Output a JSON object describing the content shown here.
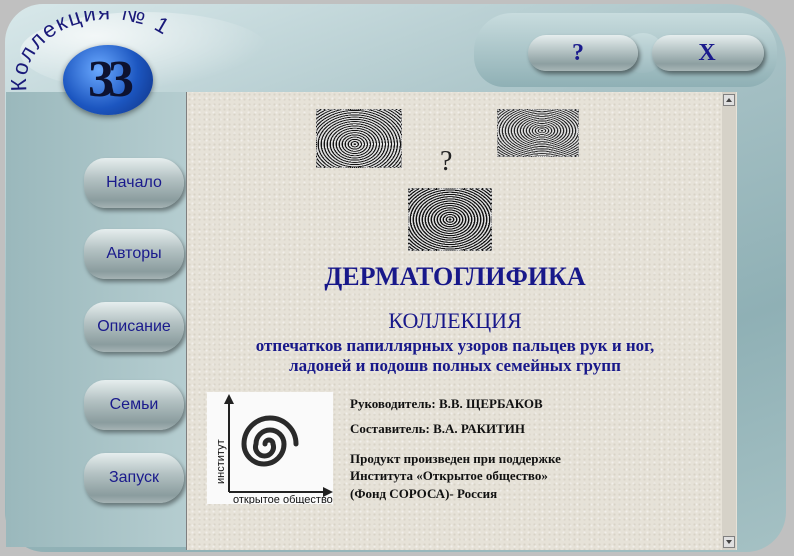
{
  "app": {
    "logo_ring_text": "Коллекция № 1",
    "logo_number": "33"
  },
  "window_controls": {
    "help_label": "?",
    "close_label": "X"
  },
  "nav": {
    "items": [
      {
        "label": "Начало"
      },
      {
        "label": "Авторы"
      },
      {
        "label": "Описание"
      },
      {
        "label": "Семьи"
      },
      {
        "label": "Запуск"
      }
    ]
  },
  "main": {
    "question_mark": "?",
    "title": "ДЕРМАТОГЛИФИКА",
    "subtitle": "КОЛЛЕКЦИЯ",
    "description_line1": "отпечатков папиллярных узоров пальцев рук и ног,",
    "description_line2": "ладоней и подошв полных семейных групп",
    "institute_logo": {
      "vertical_text": "институт",
      "bottom_text": "открытое общество"
    },
    "credits": {
      "leader": "Руководитель:  В.В. ЩЕРБАКОВ",
      "compiler": "Составитель: В.А. РАКИТИН",
      "support_line1": "Продукт произведен при поддержке",
      "support_line2": "Института «Открытое общество»",
      "support_line3": "(Фонд  СОРОСА)- Россия"
    }
  },
  "colors": {
    "accent": "#18188a",
    "frame": "#a9c3c7",
    "content_bg": "#e6e2d8"
  }
}
